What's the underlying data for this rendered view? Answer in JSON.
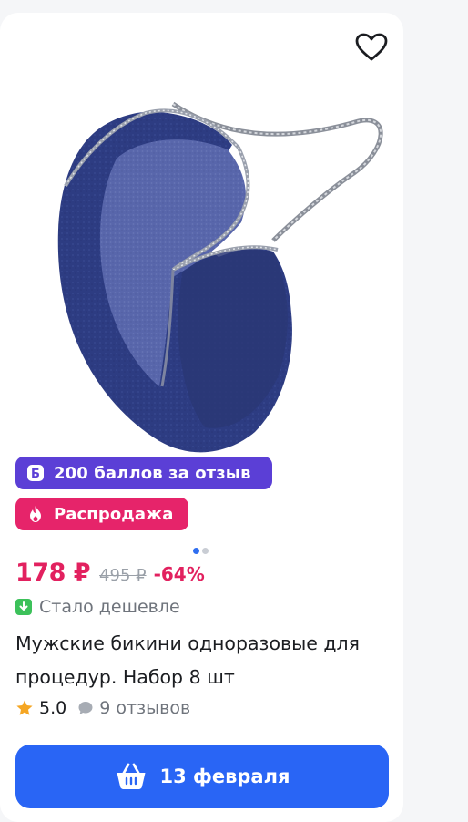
{
  "product": {
    "image": {
      "icon": "disposable-briefs-product-photo",
      "color": "#2b3a80"
    },
    "favorite_icon": "heart-outline-icon",
    "badges": {
      "points_label": "200 баллов за отзыв",
      "points_icon": "b-coin-icon",
      "points_color": "#5b3fd6",
      "sale_label": "Распродажа",
      "sale_icon": "fire-icon",
      "sale_color": "#e6246a"
    },
    "gallery": {
      "total": 2,
      "active": 1
    },
    "price": {
      "current": "178 ₽",
      "old": "495 ₽",
      "discount": "-64%"
    },
    "price_drop_label": "Стало дешевле",
    "title": "Мужские бикини одноразовые для процедур. Набор 8 шт",
    "rating": "5.0",
    "reviews": "9 отзывов",
    "delivery_button": {
      "label": "13 февраля",
      "icon": "basket-icon",
      "color": "#2965f5"
    }
  }
}
